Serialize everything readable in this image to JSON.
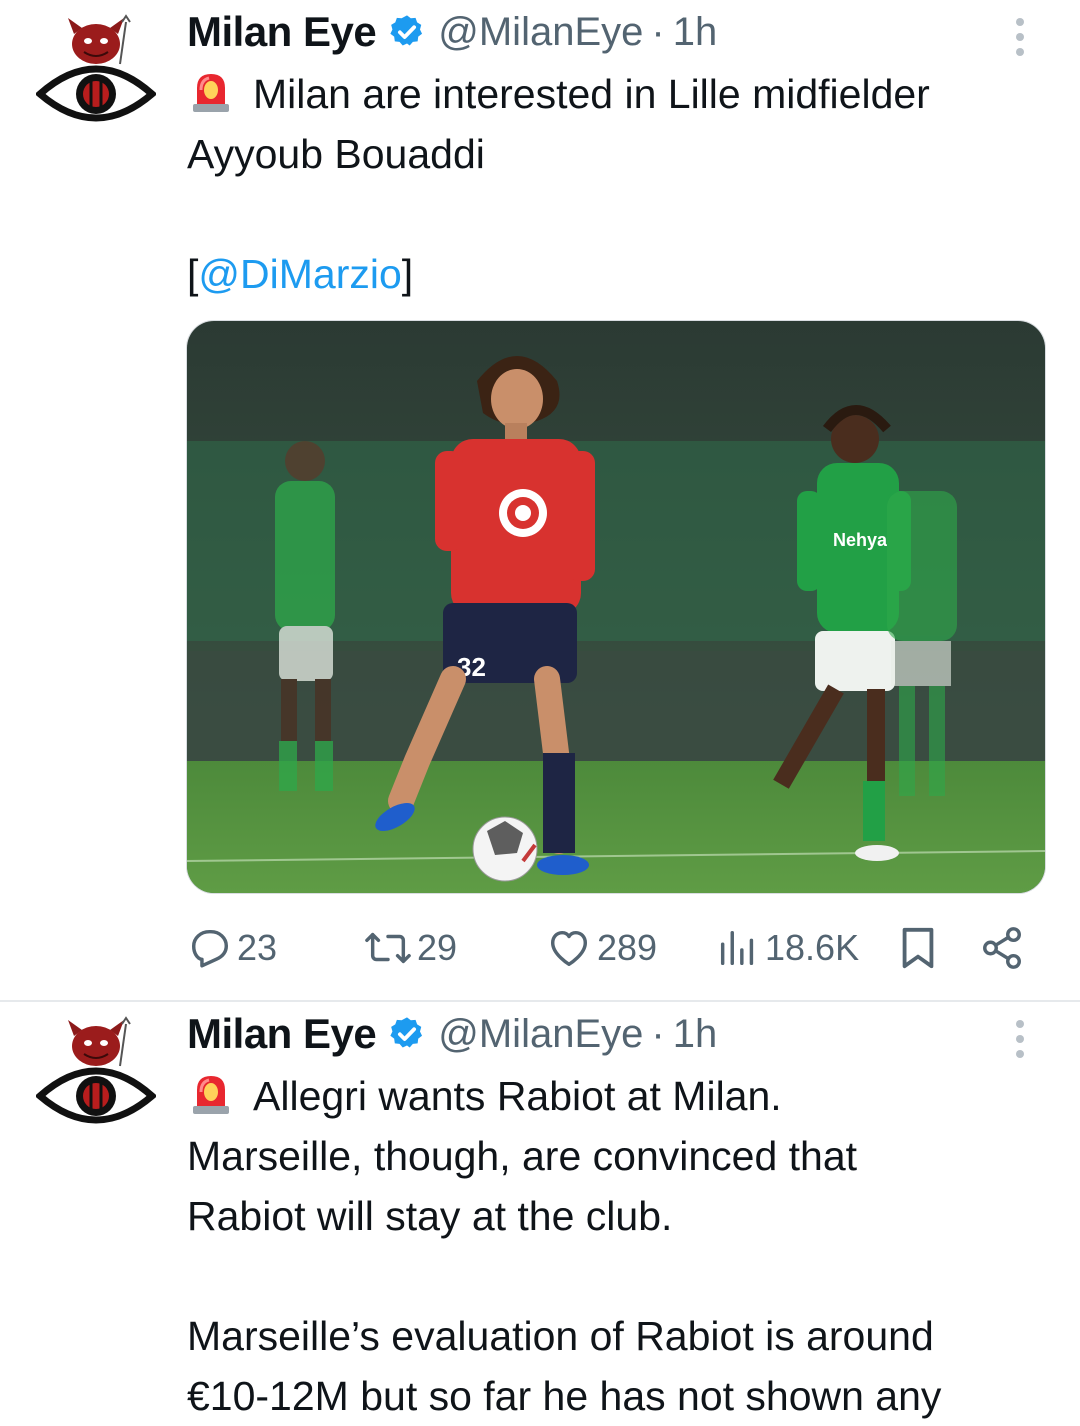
{
  "tweets": [
    {
      "author_name": "Milan Eye",
      "handle": "@MilanEye",
      "separator": "·",
      "time": "1h",
      "text_line1": "Milan are interested in Lille midfielder",
      "text_line2": "Ayyoub Bouaddi",
      "mention": "[@DiMarzio]",
      "image_jersey_number": "32",
      "stats": {
        "replies": "23",
        "reposts": "29",
        "likes": "289",
        "views": "18.6K"
      }
    },
    {
      "author_name": "Milan Eye",
      "handle": "@MilanEye",
      "separator": "·",
      "time": "1h",
      "text_line1": "Allegri wants Rabiot at Milan.",
      "text_line2": "Marseille, though, are convinced that",
      "text_line3": "Rabiot will stay at the club.",
      "text_line4": "Marseille’s evaluation of Rabiot is around",
      "text_line5": "€10-12M but so far he has not shown any"
    }
  ],
  "icons": {
    "verified": "verified-badge-icon",
    "siren": "siren-emoji-icon",
    "reply": "reply-icon",
    "repost": "repost-icon",
    "like": "heart-icon",
    "views": "views-chart-icon",
    "bookmark": "bookmark-icon",
    "share": "share-icon",
    "more": "more-vertical-icon"
  },
  "colors": {
    "link": "#1d9bf0",
    "secondary_text": "#536471",
    "verified_blue": "#1d9bf0",
    "avatar_red": "#9b1c1c"
  }
}
